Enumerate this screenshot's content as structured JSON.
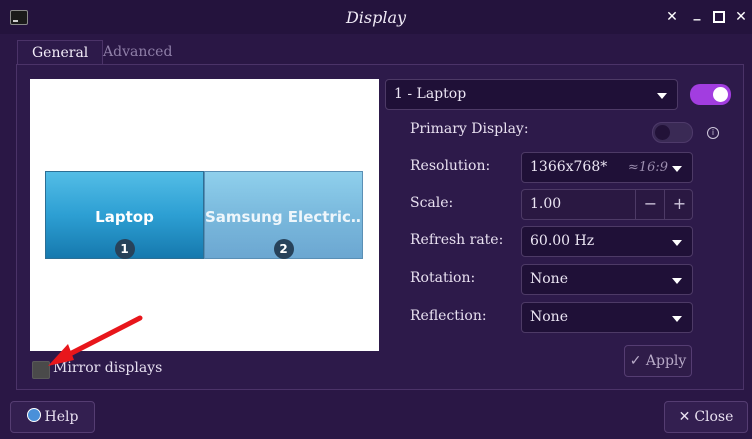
{
  "window": {
    "title": "Display"
  },
  "tabs": {
    "general": "General",
    "advanced": "Advanced"
  },
  "monitors": [
    {
      "label": "Laptop",
      "number": "1"
    },
    {
      "label": "Samsung Electric…",
      "number": "2"
    }
  ],
  "mirror": {
    "label": "Mirror displays",
    "checked": false
  },
  "display_select": {
    "value": "1 - Laptop",
    "enabled": true
  },
  "settings": {
    "primary_label": "Primary Display:",
    "primary_on": false,
    "info_glyph": "i",
    "resolution_label": "Resolution:",
    "resolution_value": "1366x768*",
    "resolution_ratio": "≈16:9",
    "scale_label": "Scale:",
    "scale_value": "1.00",
    "scale_minus": "−",
    "scale_plus": "+",
    "refresh_label": "Refresh rate:",
    "refresh_value": "60.00 Hz",
    "rotation_label": "Rotation:",
    "rotation_value": "None",
    "reflection_label": "Reflection:",
    "reflection_value": "None"
  },
  "buttons": {
    "apply": "Apply",
    "help": "Help",
    "close": "Close",
    "apply_check": "✓",
    "close_x": "✕"
  },
  "colors": {
    "toggle_on": "#a23de0",
    "toggle_off": "#3a2a55",
    "accent": "#a23de0"
  },
  "icons": [
    "terminal-icon",
    "close-icon",
    "minimize-icon",
    "maximize-icon",
    "info-icon",
    "checkmark-icon",
    "help-icon",
    "chevron-down-icon"
  ]
}
